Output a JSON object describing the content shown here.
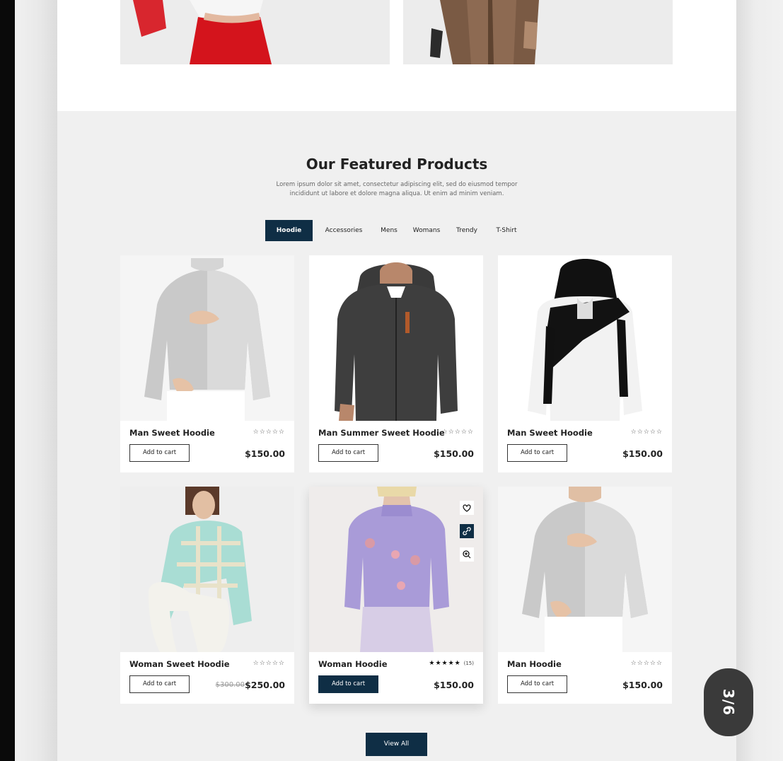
{
  "section": {
    "title": "Our Featured Products",
    "subtitle": "Lorem ipsum dolor sit amet, consectetur adipiscing elit, sed do eiusmod tempor incididunt ut labore et dolore magna aliqua. Ut enim ad minim veniam."
  },
  "tabs": [
    "Hoodie",
    "Accessories",
    "Mens",
    "Womans",
    "Trendy",
    "T-Shirt"
  ],
  "active_tab": "Hoodie",
  "products": [
    {
      "name": "Man Sweet Hoodie",
      "price": "$150.00",
      "button": "Add to cart",
      "stars": "☆☆☆☆☆"
    },
    {
      "name": "Man Summer Sweet Hoodie",
      "price": "$150.00",
      "button": "Add to cart",
      "stars": "☆☆☆☆☆"
    },
    {
      "name": "Man Sweet Hoodie",
      "price": "$150.00",
      "button": "Add to cart",
      "stars": "☆☆☆☆☆"
    },
    {
      "name": "Woman Sweet Hoodie",
      "price": "$250.00",
      "old_price": "$300.00",
      "button": "Add to cart",
      "stars": "☆☆☆☆☆"
    },
    {
      "name": "Woman Hoodie",
      "price": "$150.00",
      "button": "Add to cart",
      "stars": "★★★★★",
      "review_count": "(15)"
    },
    {
      "name": "Man Hoodie",
      "price": "$150.00",
      "button": "Add to cart",
      "stars": "☆☆☆☆☆"
    }
  ],
  "view_all": "View All",
  "pager": "3/6",
  "colors": {
    "accent": "#0f2e45",
    "page_bg": "#f0f0f0",
    "card_bg": "#ffffff"
  },
  "icons": {
    "wishlist": "heart-icon",
    "link": "link-icon",
    "zoom": "zoom-icon"
  }
}
